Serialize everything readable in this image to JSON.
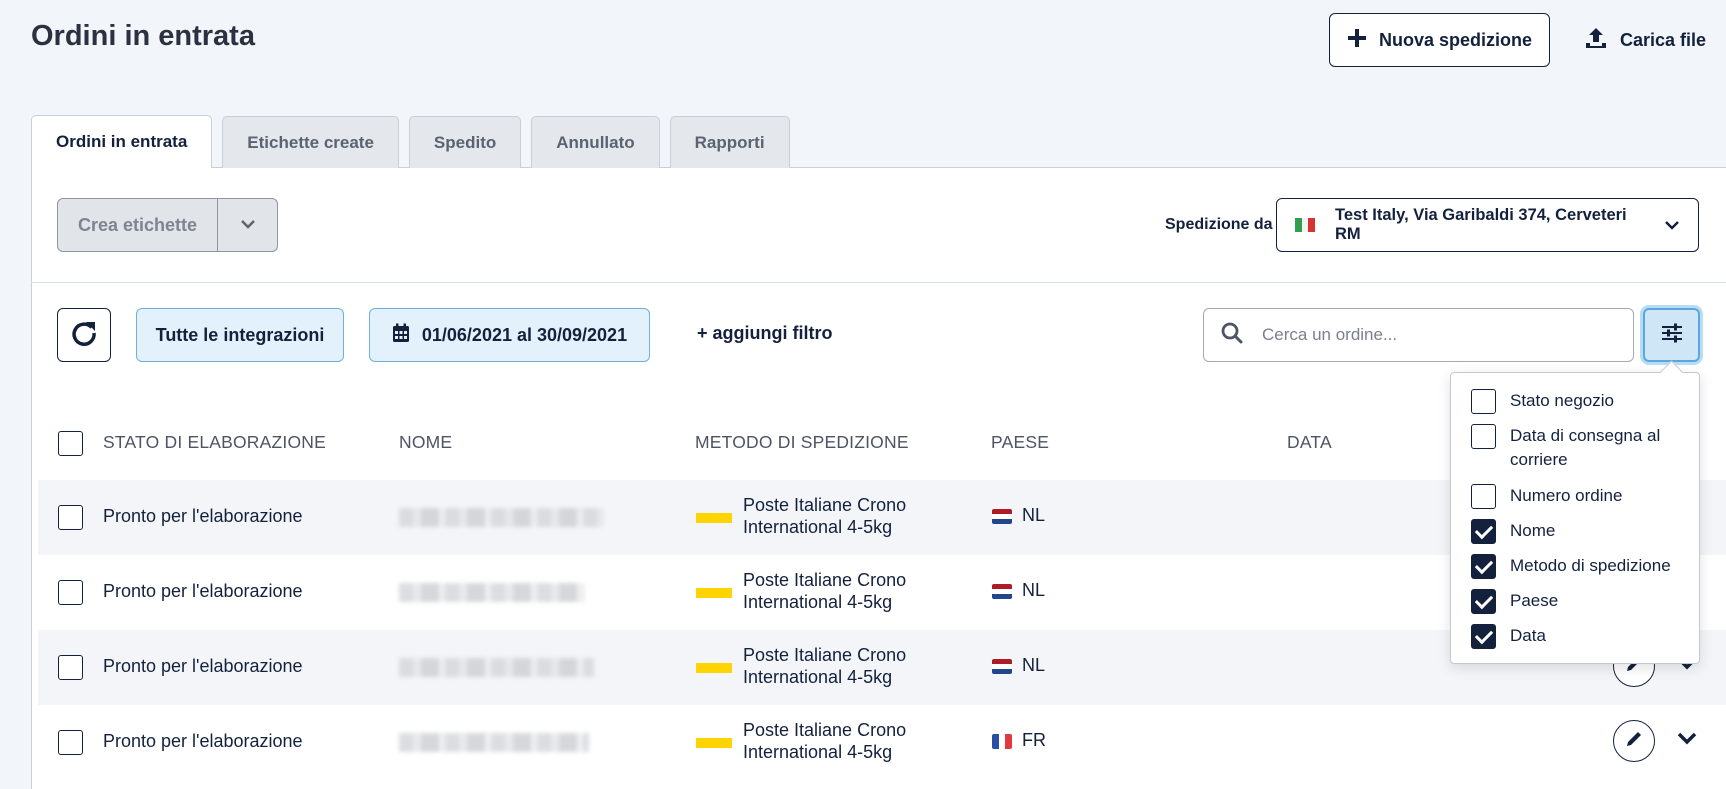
{
  "header": {
    "title": "Ordini in entrata",
    "new_shipment": "Nuova spedizione",
    "upload": "Carica file"
  },
  "tabs": [
    {
      "label": "Ordini in entrata",
      "active": true
    },
    {
      "label": "Etichette create"
    },
    {
      "label": "Spedito"
    },
    {
      "label": "Annullato"
    },
    {
      "label": "Rapporti"
    }
  ],
  "toolbar": {
    "create_labels": "Crea etichette",
    "ship_from_label": "Spedizione da",
    "ship_from_value": "Test Italy, Via Garibaldi 374, Cerveteri RM"
  },
  "filters": {
    "integrations": "Tutte le integrazioni",
    "date_range": "01/06/2021 al 30/09/2021",
    "add_filter": "+ aggiungi filtro",
    "search_placeholder": "Cerca un ordine..."
  },
  "table": {
    "headers": [
      "STATO DI ELABORAZIONE",
      "NOME",
      "METODO DI SPEDIZIONE",
      "PAESE",
      "DATA"
    ],
    "rows": [
      {
        "status": "Pronto per l'elaborazione",
        "method": "Poste Italiane Crono International 4-5kg",
        "country": "NL"
      },
      {
        "status": "Pronto per l'elaborazione",
        "method": "Poste Italiane Crono International 4-5kg",
        "country": "NL"
      },
      {
        "status": "Pronto per l'elaborazione",
        "method": "Poste Italiane Crono International 4-5kg",
        "country": "NL"
      },
      {
        "status": "Pronto per l'elaborazione",
        "method": "Poste Italiane Crono International 4-5kg",
        "country": "FR"
      }
    ]
  },
  "column_menu": {
    "options": [
      {
        "label": "Stato negozio",
        "checked": false
      },
      {
        "label": "Data di consegna al corriere",
        "checked": false
      },
      {
        "label": "Numero ordine",
        "checked": false
      },
      {
        "label": "Nome",
        "checked": true
      },
      {
        "label": "Metodo di spedizione",
        "checked": true
      },
      {
        "label": "Paese",
        "checked": true
      },
      {
        "label": "Data",
        "checked": true
      }
    ]
  },
  "colors": {
    "navy": "#14213d",
    "chip_bg": "#e2f1fb",
    "chip_border": "#6fb1dc",
    "poste_yellow": "#ffd400"
  },
  "icons": {
    "new_shipment": "plus-icon",
    "upload": "upload-icon",
    "refresh": "refresh-icon",
    "calendar": "calendar-icon",
    "search": "search-icon",
    "columns": "sliders-icon",
    "edit": "pencil-icon",
    "expand": "chevron-down-icon"
  }
}
